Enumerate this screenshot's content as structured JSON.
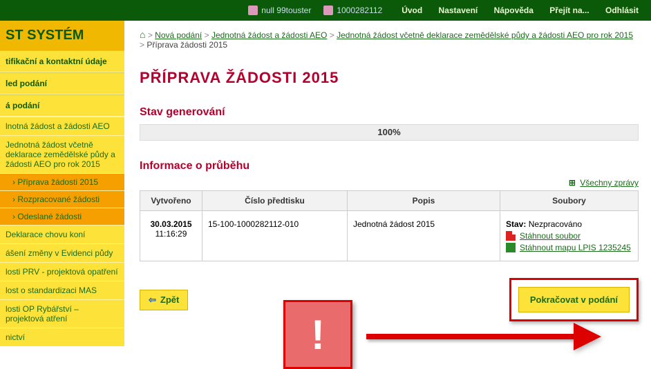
{
  "topbar": {
    "user1": "null 99touster",
    "user2": "1000282112",
    "nav": [
      "Úvod",
      "Nastavení",
      "Nápověda",
      "Přejít na...",
      "Odhlásit"
    ]
  },
  "sidebar": {
    "title": "ST SYSTÉM",
    "head1": "tifikační a kontaktní údaje",
    "head2": "led podání",
    "head3": "á podání",
    "items": [
      {
        "label": "lnotná žádost a žádosti AEO",
        "kind": "item"
      },
      {
        "label": "Jednotná žádost včetně deklarace zemědělské půdy a žádosti AEO pro rok 2015",
        "kind": "item"
      },
      {
        "label": "Příprava žádosti 2015",
        "kind": "subitem_orange",
        "prefix": "›"
      },
      {
        "label": "Rozpracované žádosti",
        "kind": "subitem_orange",
        "prefix": "›"
      },
      {
        "label": "Odeslané žádosti",
        "kind": "subitem_orange",
        "prefix": "›"
      },
      {
        "label": "Deklarace chovu koní",
        "kind": "item"
      },
      {
        "label": "ášení změny v Evidenci půdy",
        "kind": "item"
      },
      {
        "label": "losti PRV - projektová opatření",
        "kind": "item"
      },
      {
        "label": "lost o standardizaci MAS",
        "kind": "item"
      },
      {
        "label": "losti OP Rybářství – projektová atření",
        "kind": "item"
      },
      {
        "label": "nictví",
        "kind": "item"
      }
    ]
  },
  "breadcrumb": {
    "items": [
      {
        "text": "Nová podání",
        "link": true
      },
      {
        "text": "Jednotná žádost a žádosti AEO",
        "link": true
      },
      {
        "text": "Jednotná žádost včetně deklarace zemědělské půdy a žádosti AEO pro rok 2015",
        "link": true
      },
      {
        "text": "Příprava žádosti 2015",
        "link": false
      }
    ],
    "sep": ">"
  },
  "page": {
    "title": "PŘÍPRAVA ŽÁDOSTI 2015",
    "section1": "Stav generování",
    "progress_label": "100%",
    "progress_value": 100,
    "section2": "Informace o průběhu",
    "all_messages": "Všechny zprávy"
  },
  "table": {
    "headers": [
      "Vytvořeno",
      "Číslo předtisku",
      "Popis",
      "Soubory"
    ],
    "row": {
      "date": "30.03.2015",
      "time": "11:16:29",
      "number": "15-100-1000282112-010",
      "desc": "Jednotná žádost 2015",
      "files": {
        "status_label": "Stav:",
        "status_value": "Nezpracováno",
        "pdf": "Stáhnout soubor",
        "xls": "Stáhnout mapu LPIS 1235245"
      }
    }
  },
  "buttons": {
    "back": "Zpět",
    "continue": "Pokračovat v podání"
  }
}
